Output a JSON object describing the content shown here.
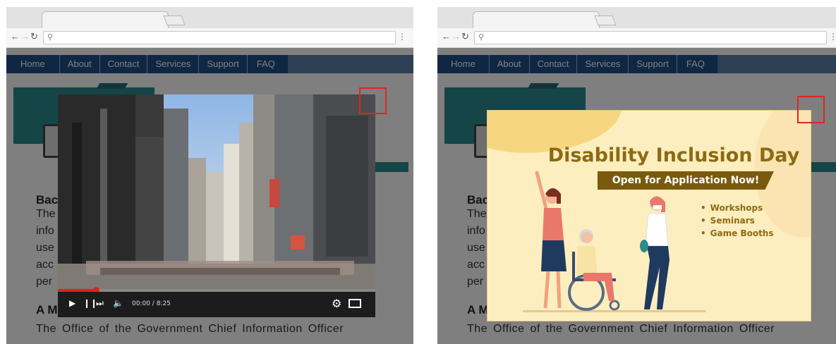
{
  "colors": {
    "nav_bg": "#1f4f86",
    "nav_strip": "#5b7ea7",
    "banner_teal": "#2b8a8c",
    "highlight_red": "#e02424",
    "popup_bg": "#fdeebf",
    "popup_gold": "#8c6a13",
    "progress_red": "#e02020"
  },
  "icons": {
    "back": "arrow-left-icon",
    "forward": "arrow-right-icon",
    "reload": "reload-icon",
    "search": "search-icon",
    "menu": "kebab-menu-icon",
    "play": "play-icon",
    "pause": "pause-icon",
    "next": "skip-next-icon",
    "volume": "volume-icon",
    "settings": "gear-icon",
    "fullscreen": "fullscreen-icon"
  },
  "nav": {
    "items": [
      "Home",
      "About",
      "Contact",
      "Services",
      "Support",
      "FAQ"
    ]
  },
  "left_panel": {
    "page": {
      "heading1_partial": "Bac",
      "para_fragments": [
        "The",
        "info",
        "use",
        "acc",
        "per"
      ],
      "heading2_partial": "A M",
      "footer": "The Office of the Government Chief Information Officer"
    },
    "video": {
      "time": "00:00 / 8:25",
      "progress": 0.12
    }
  },
  "right_panel": {
    "page": {
      "heading1_partial": "Bac",
      "para_fragments": [
        "The",
        "info",
        "use",
        "acc",
        "per"
      ],
      "heading2_partial": "A M",
      "footer": "The Office of the Government Chief Information Officer"
    },
    "popup": {
      "title": "Disability Inclusion Day",
      "subtitle": "Open for Application Now!",
      "items": [
        "Workshops",
        "Seminars",
        "Game Booths"
      ]
    }
  }
}
